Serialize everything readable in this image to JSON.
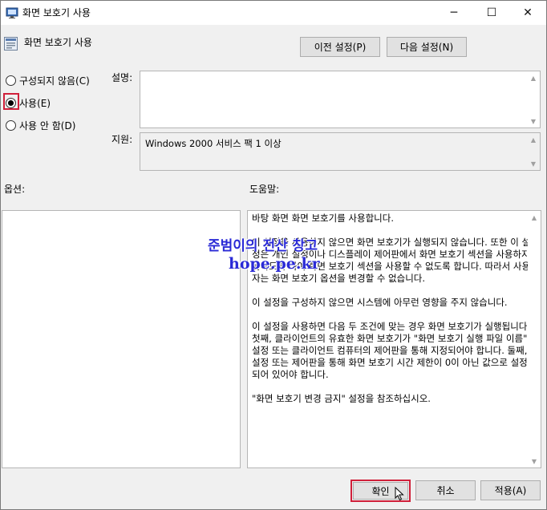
{
  "window": {
    "title": "화면 보호기 사용",
    "controls": {
      "minimize": "─",
      "maximize": "☐",
      "close": "✕"
    }
  },
  "policy": {
    "title": "화면 보호기 사용",
    "prev_label": "이전 설정(P)",
    "next_label": "다음 설정(N)"
  },
  "state": {
    "options": [
      {
        "label": "구성되지 않음(C)",
        "selected": false
      },
      {
        "label": "사용(E)",
        "selected": true
      },
      {
        "label": "사용 안 함(D)",
        "selected": false
      }
    ]
  },
  "comment": {
    "label": "설명:",
    "value": ""
  },
  "supported": {
    "label": "지원:",
    "value": "Windows 2000 서비스 팩 1 이상"
  },
  "options_panel": {
    "label": "옵션:"
  },
  "help": {
    "label": "도움말:",
    "paragraphs": [
      "바탕 화면 화면 보호기를 사용합니다.",
      "이 설정을 사용하지 않으면 화면 보호기가 실행되지 않습니다. 또한 이 설정은 개인 설정이나 디스플레이 제어판에서 화면 보호기 섹션을 사용하지 못하도록 하여 화면 보호기 섹션을 사용할 수 없도록 합니다. 따라서 사용자는 화면 보호기 옵션을 변경할 수 없습니다.",
      "이 설정을 구성하지 않으면 시스템에 아무런 영향을 주지 않습니다.",
      "이 설정을 사용하면 다음 두 조건에 맞는 경우 화면 보호기가 실행됩니다. 첫째, 클라이언트의 유효한 화면 보호기가 \"화면 보호기 실행 파일 이름\" 설정 또는 클라이언트 컴퓨터의 제어판을 통해 지정되어야 합니다. 둘째, 설정 또는 제어판을 통해 화면 보호기 시간 제한이 0이 아닌 값으로 설정되어 있어야 합니다.",
      "\"화면 보호기 변경 금지\" 설정을 참조하십시오."
    ]
  },
  "footer": {
    "ok_label": "확인",
    "cancel_label": "취소",
    "apply_label": "적용(A)"
  },
  "watermark": {
    "line1": "준범이의 전산 창고",
    "line2": "hope.pe.kr"
  },
  "colors": {
    "highlight": "#d0203a",
    "watermark": "#2a2ad6"
  },
  "icons": [
    "gpo-settings-icon",
    "policy-setting-icon",
    "minimize-icon",
    "maximize-icon",
    "close-icon",
    "mouse-cursor-icon"
  ]
}
